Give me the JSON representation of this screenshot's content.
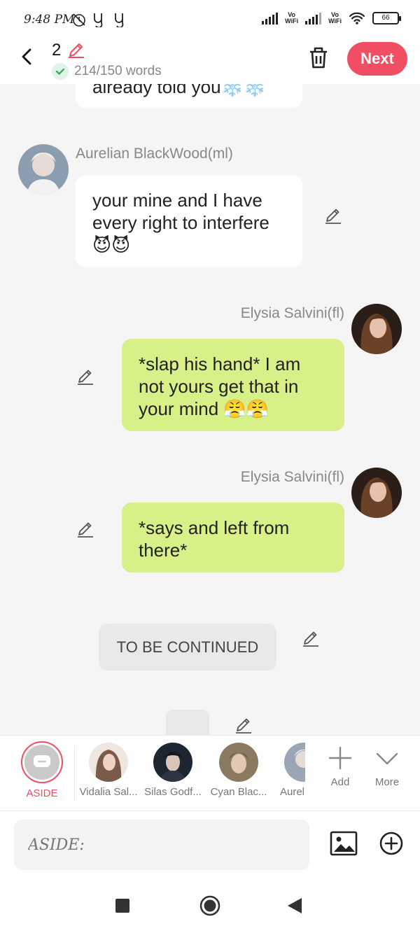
{
  "status_bar": {
    "time": "9:48 PM",
    "icons": [
      "alarm-off-icon",
      "y-icon",
      "y-icon",
      "signal-icon",
      "vo-wifi-icon",
      "signal-icon",
      "vo-wifi-icon",
      "wifi-icon",
      "battery-icon"
    ],
    "vo_label": "Vo\nWiFi",
    "battery": "66"
  },
  "header": {
    "count": "2",
    "word_count": "214/150 words",
    "next_label": "Next"
  },
  "messages": [
    {
      "side": "left",
      "text": "already told you❄️❄️"
    },
    {
      "side": "left",
      "name": "Aurelian BlackWood(ml)",
      "text": "your mine and I have every right to interfere 😈😈"
    },
    {
      "side": "right",
      "name": "Elysia Salvini(fl)",
      "text": "*slap his hand* I am not yours get that in your mind 😤😤"
    },
    {
      "side": "right",
      "name": "Elysia Salvini(fl)",
      "text": "*says and left from there*"
    }
  ],
  "narration": "TO BE CONTINUED",
  "characters": [
    {
      "label": "ASIDE",
      "icon": "chat-bubble-icon"
    },
    {
      "label": "Vidalia Sal..."
    },
    {
      "label": "Silas Godf..."
    },
    {
      "label": "Cyan Blac..."
    },
    {
      "label": "Aureli"
    },
    {
      "label": "Add",
      "icon": "plus-icon"
    },
    {
      "label": "More",
      "icon": "chevron-down-icon"
    }
  ],
  "input": {
    "placeholder": "ASIDE:"
  },
  "colors": {
    "accent": "#f14e64",
    "right_bubble": "#d7f087",
    "left_bubble": "#ffffff",
    "background": "#f5f5f5"
  }
}
